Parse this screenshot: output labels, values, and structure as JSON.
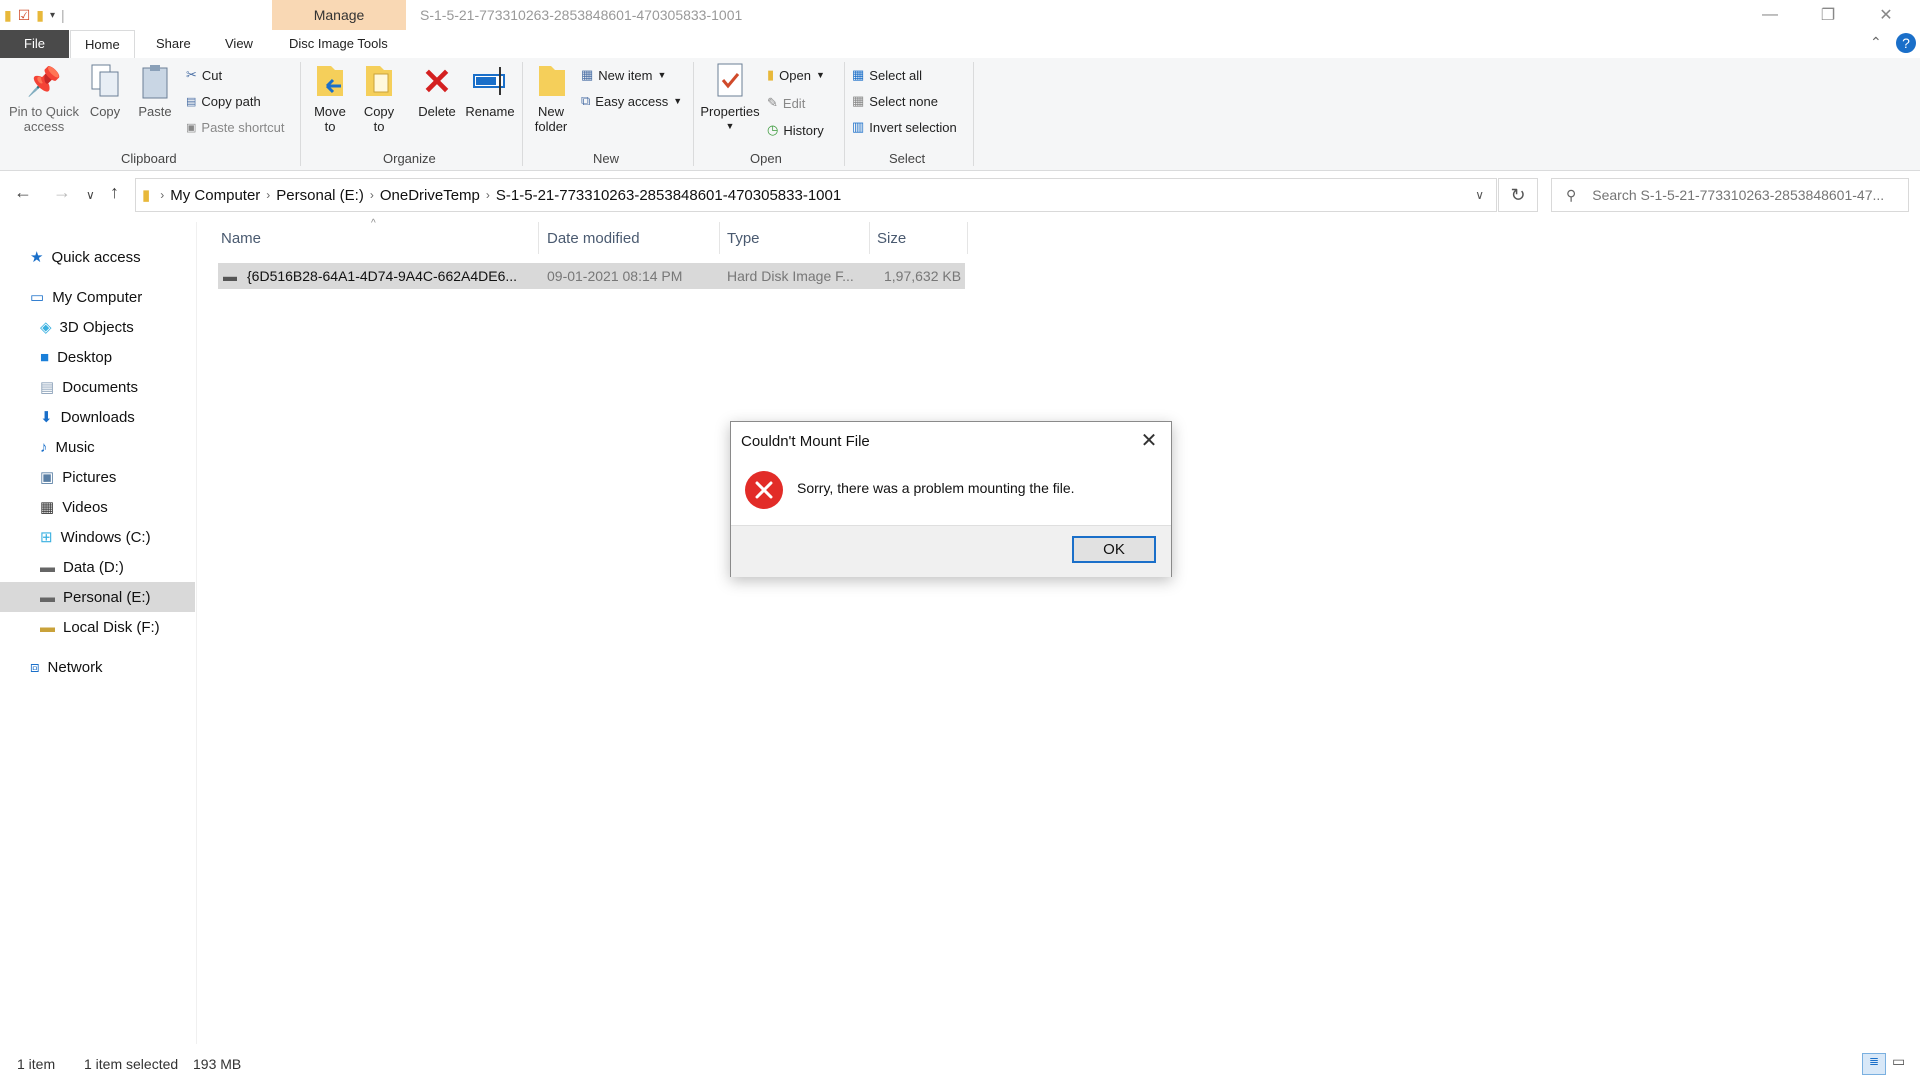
{
  "window": {
    "title": "S-1-5-21-773310263-2853848601-470305833-1001",
    "contextual_tab_group": "Manage",
    "minimize_icon": "minimize-icon",
    "restore_icon": "restore-icon",
    "close_icon": "close-icon"
  },
  "tabs": {
    "file": "File",
    "home": "Home",
    "share": "Share",
    "view": "View",
    "disc_image_tools": "Disc Image Tools"
  },
  "ribbon": {
    "clipboard": {
      "group_label": "Clipboard",
      "pin_label_1": "Pin to Quick",
      "pin_label_2": "access",
      "copy": "Copy",
      "paste": "Paste",
      "cut": "Cut",
      "copy_path": "Copy path",
      "paste_shortcut": "Paste shortcut"
    },
    "organize": {
      "group_label": "Organize",
      "move_to_1": "Move",
      "move_to_2": "to",
      "copy_to_1": "Copy",
      "copy_to_2": "to",
      "delete": "Delete",
      "rename": "Rename"
    },
    "new": {
      "group_label": "New",
      "new_folder_1": "New",
      "new_folder_2": "folder",
      "new_item": "New item",
      "easy_access": "Easy access"
    },
    "open": {
      "group_label": "Open",
      "properties": "Properties",
      "open": "Open",
      "edit": "Edit",
      "history": "History"
    },
    "select": {
      "group_label": "Select",
      "select_all": "Select all",
      "select_none": "Select none",
      "invert_selection": "Invert selection"
    }
  },
  "address": {
    "crumbs": [
      "My Computer",
      "Personal (E:)",
      "OneDriveTemp",
      "S-1-5-21-773310263-2853848601-470305833-1001"
    ],
    "search_placeholder": "Search S-1-5-21-773310263-2853848601-47..."
  },
  "sidebar": {
    "quick_access": "Quick access",
    "my_computer": "My Computer",
    "items": [
      "3D Objects",
      "Desktop",
      "Documents",
      "Downloads",
      "Music",
      "Pictures",
      "Videos",
      "Windows (C:)",
      "Data (D:)",
      "Personal (E:)",
      "Local Disk (F:)"
    ],
    "network": "Network"
  },
  "file_list": {
    "columns": [
      "Name",
      "Date modified",
      "Type",
      "Size"
    ],
    "rows": [
      {
        "name": "{6D516B28-64A1-4D74-9A4C-662A4DE6...",
        "date": "09-01-2021 08:14 PM",
        "type": "Hard Disk Image F...",
        "size": "1,97,632 KB"
      }
    ]
  },
  "status": {
    "count": "1 item",
    "selection": "1 item selected",
    "size": "193 MB"
  },
  "dialog": {
    "title": "Couldn't Mount File",
    "message": "Sorry, there was a problem mounting the file.",
    "ok": "OK"
  }
}
